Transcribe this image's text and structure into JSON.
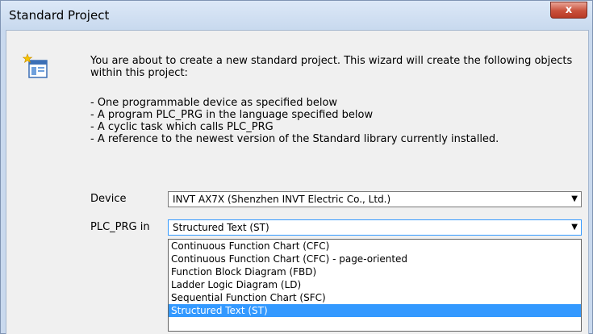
{
  "window": {
    "title": "Standard Project",
    "close_label": "x"
  },
  "intro": "You are about to create a new standard project. This wizard will create the following objects within this project:",
  "bullets": [
    "- One programmable device as specified below",
    "- A program PLC_PRG in the language specified below",
    "- A cyclic task which calls PLC_PRG",
    "- A reference to the newest version of the Standard library currently installed."
  ],
  "device": {
    "label": "Device",
    "value": "INVT AX7X (Shenzhen INVT Electric Co., Ltd.)"
  },
  "language": {
    "label": "PLC_PRG in",
    "value": "Structured Text (ST)",
    "options": [
      "Continuous Function Chart (CFC)",
      "Continuous Function Chart (CFC) - page-oriented",
      "Function Block Diagram (FBD)",
      "Ladder Logic Diagram (LD)",
      "Sequential Function Chart (SFC)",
      "Structured Text (ST)"
    ],
    "selected_index": 5
  },
  "colors": {
    "highlight": "#3399ff",
    "title_bg": "#c9d9ee",
    "close_button": "#c9503b"
  },
  "icons": {
    "wizard": "wizard-icon",
    "combo_arrow": "chevron-down-icon"
  }
}
